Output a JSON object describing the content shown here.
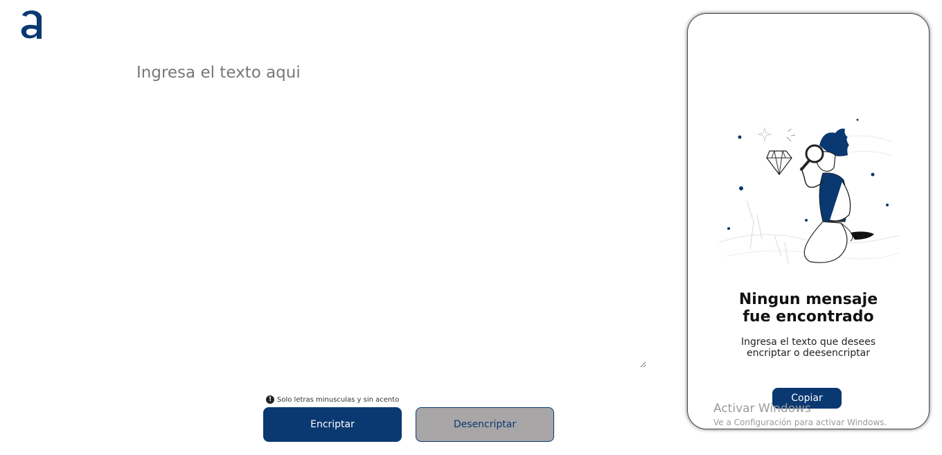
{
  "brand": {
    "logo_icon": "alura-a-logo-icon",
    "accent_color": "#0a3871"
  },
  "input": {
    "placeholder": "Ingresa el texto aqui",
    "value": ""
  },
  "hint": {
    "icon": "info-icon",
    "text": "Solo letras minusculas y sin acento"
  },
  "buttons": {
    "encrypt_label": "Encriptar",
    "decrypt_label": "Desencriptar",
    "copy_label": "Copiar"
  },
  "panel": {
    "illustration": "person-with-magnifier-illustration",
    "title": "Ningun mensaje fue encontrado",
    "subtitle": "Ingresa el texto que desees encriptar o deesencriptar"
  },
  "watermark": {
    "title": "Activar Windows",
    "subtitle": "Ve a Configuración para activar Windows."
  }
}
